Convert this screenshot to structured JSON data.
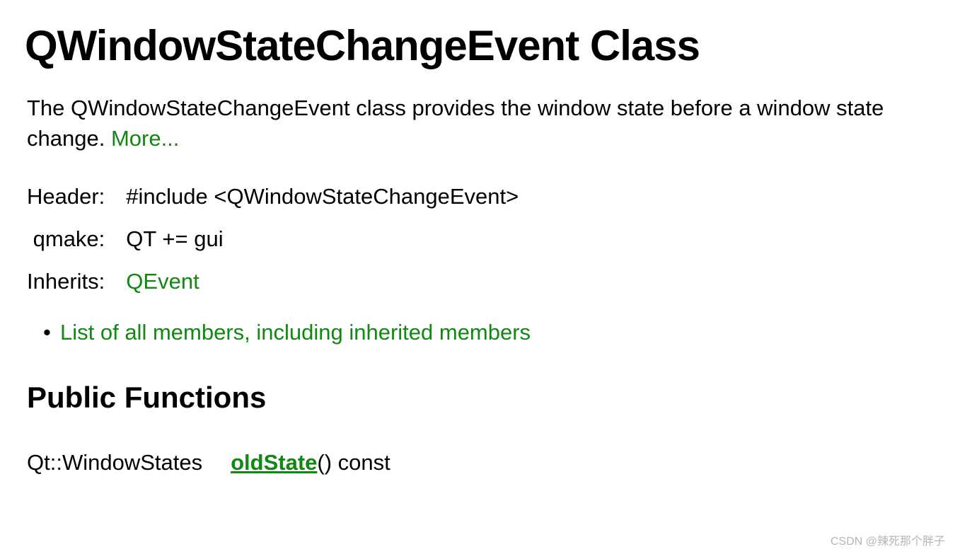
{
  "title": "QWindowStateChangeEvent Class",
  "description_prefix": "The QWindowStateChangeEvent class provides the window state before a window state change. ",
  "more_link": "More...",
  "info": {
    "header_label": "Header:",
    "header_value": "#include <QWindowStateChangeEvent>",
    "qmake_label": "qmake:",
    "qmake_value": "QT += gui",
    "inherits_label": "Inherits:",
    "inherits_value": "QEvent"
  },
  "members_link": "List of all members, including inherited members",
  "section_public_functions": "Public Functions",
  "functions": [
    {
      "return_type": "Qt::WindowStates",
      "name": "oldState",
      "signature_suffix": "() const"
    }
  ],
  "watermark": "CSDN @辣死那个胖子"
}
